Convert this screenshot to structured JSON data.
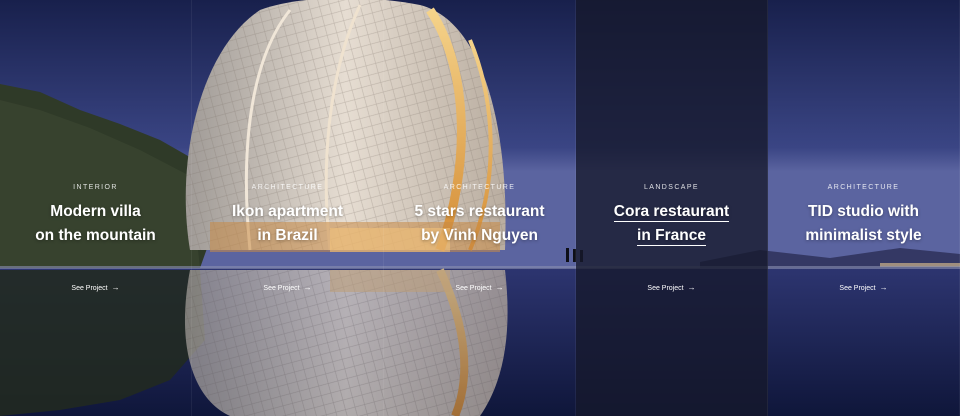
{
  "colors": {
    "sky_top": "#1b2352",
    "sky_bottom": "#4a5592",
    "active_overlay": "#16182c"
  },
  "projects": [
    {
      "category": "Interior",
      "title_line1": "Modern  villa",
      "title_line2": "on the mountain",
      "link": "See Project",
      "active": false
    },
    {
      "category": "Architecture",
      "title_line1": "Ikon apartment",
      "title_line2": "in Brazil",
      "link": "See Project",
      "active": false
    },
    {
      "category": "Architecture",
      "title_line1": "5 stars restaurant",
      "title_line2": "by Vinh Nguyen",
      "link": "See Project",
      "active": false
    },
    {
      "category": "Landscape",
      "title_line1": "Cora restaurant",
      "title_line2": "in France",
      "link": "See Project",
      "active": true
    },
    {
      "category": "Architecture",
      "title_line1": "TID studio with",
      "title_line2": "minimalist style",
      "link": "See Project",
      "active": false
    }
  ],
  "icons": {
    "link_arrow": "arrow-right-icon"
  }
}
